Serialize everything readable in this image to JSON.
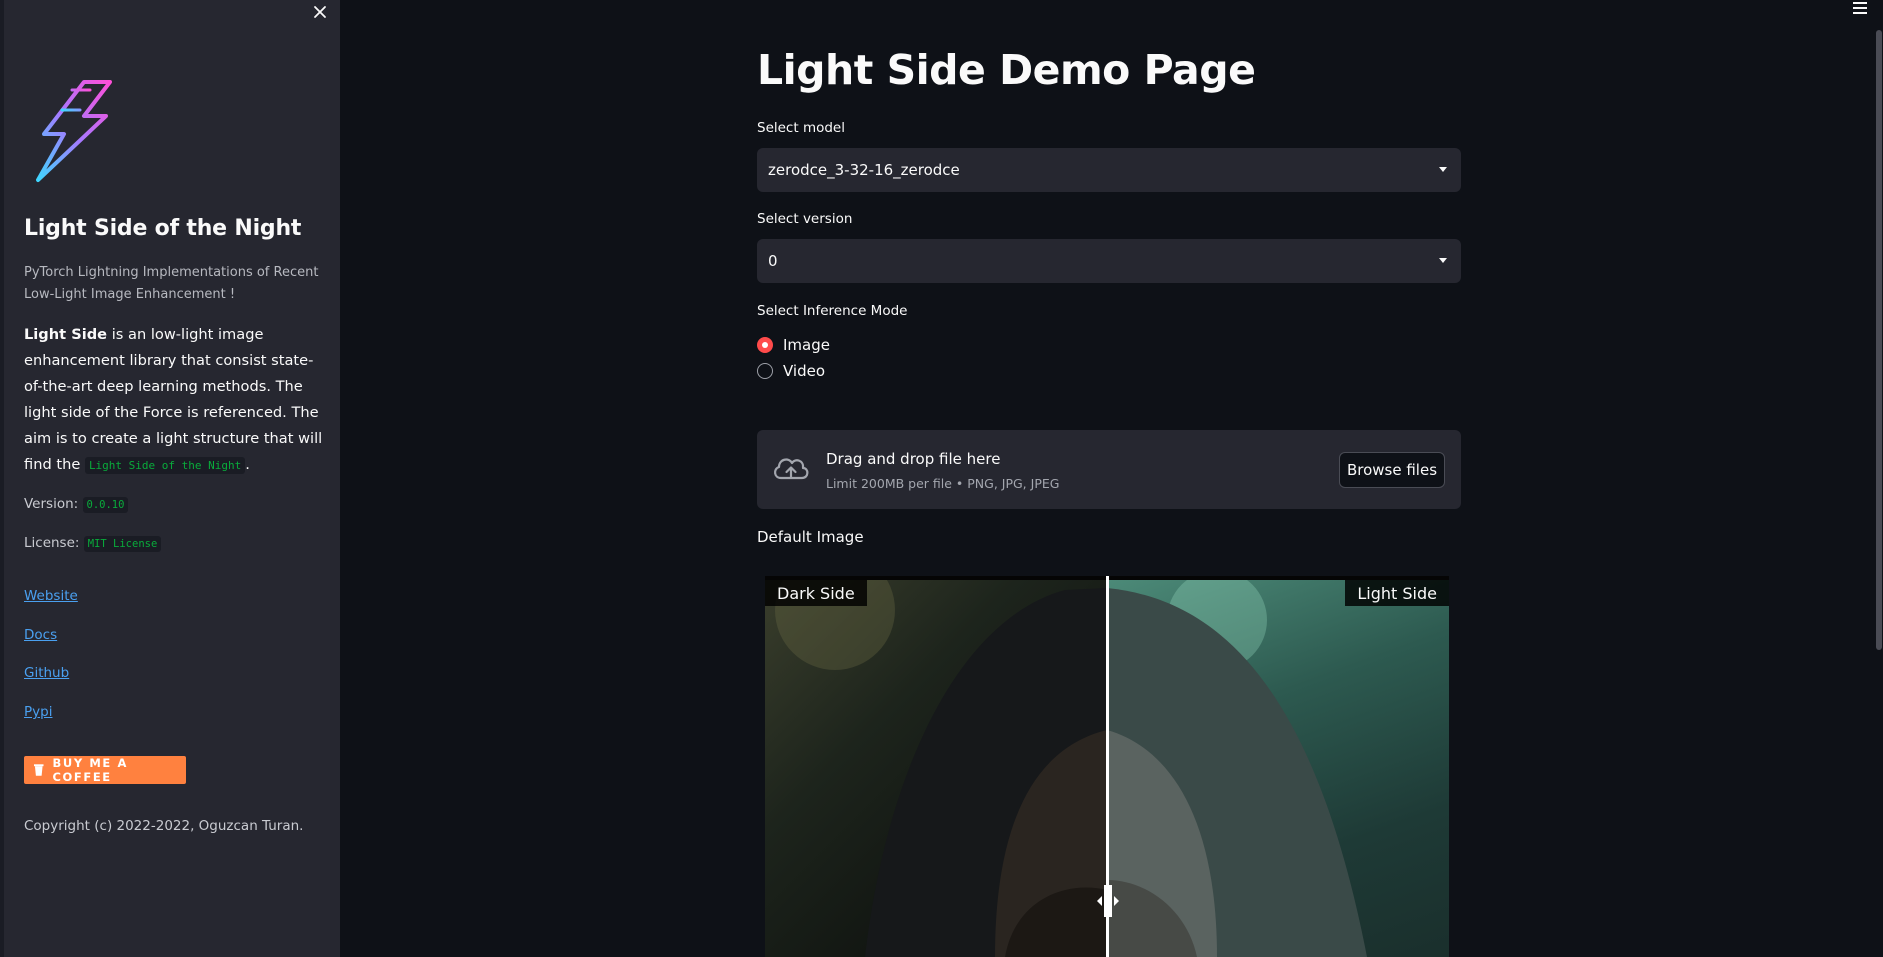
{
  "sidebar": {
    "title": "Light Side of the Night",
    "subtitle": "PyTorch Lightning Implementations of Recent Low-Light Image Enhancement !",
    "desc_bold": "Light Side",
    "desc_text": " is an low-light image enhancement library that consist state-of-the-art deep learning methods. The light side of the Force is referenced. The aim is to create a light structure that will find the ",
    "desc_code": "Light Side of the Night",
    "desc_end": ".",
    "version_label": "Version:",
    "version_value": "0.0.10",
    "license_label": "License:",
    "license_value": "MIT License",
    "links": [
      "Website",
      "Docs",
      "Github",
      "Pypi"
    ],
    "coffee_label": "BUY ME A COFFEE",
    "copyright": "Copyright (c) 2022-2022, Oguzcan Turan.",
    "colors": {
      "background": "#262730",
      "link": "#4aa0f0",
      "coffee": "#ff813f",
      "code": "#09ab3b"
    },
    "icons": {
      "close": "close-icon",
      "logo": "lightning-bolt-icon",
      "coffee": "coffee-cup-icon"
    }
  },
  "main": {
    "title": "Light Side Demo Page",
    "model": {
      "label": "Select model",
      "value": "zerodce_3-32-16_zerodce"
    },
    "version": {
      "label": "Select version",
      "value": "0"
    },
    "mode": {
      "label": "Select Inference Mode",
      "options": [
        "Image",
        "Video"
      ],
      "selected": "Image"
    },
    "uploader": {
      "title": "Drag and drop file here",
      "hint": "Limit 200MB per file • PNG, JPG, JPEG",
      "button": "Browse files"
    },
    "default_image_label": "Default Image",
    "compare": {
      "left_label": "Dark Side",
      "right_label": "Light Side",
      "split": 0.5
    },
    "colors": {
      "background": "#0e1117",
      "accent": "#ff4b4b",
      "widget": "#262730"
    },
    "icons": {
      "menu": "hamburger-menu-icon",
      "upload": "cloud-upload-icon",
      "dropdown": "chevron-down-icon",
      "slider": "slider-handle-icon"
    }
  }
}
